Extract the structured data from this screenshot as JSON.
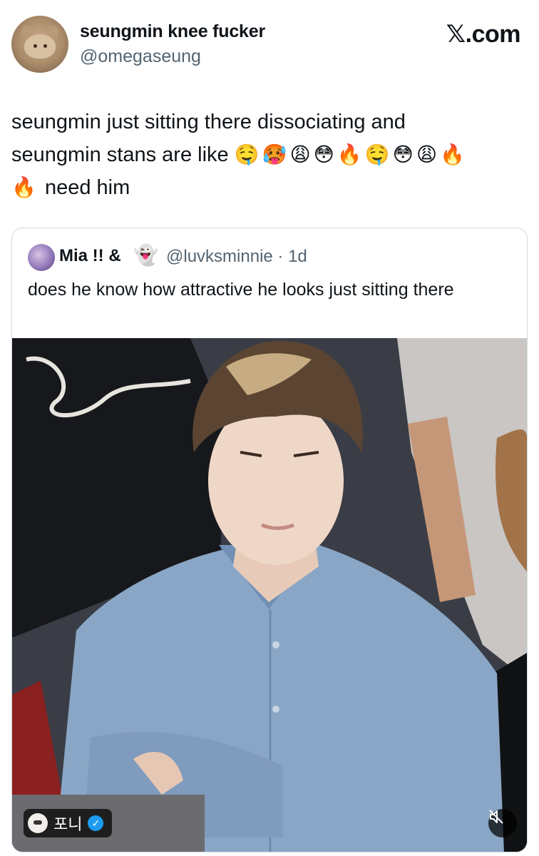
{
  "tweet": {
    "author": {
      "display_name": "seungmin knee fucker",
      "handle": "@omegaseung"
    },
    "brand": "𝕏.com",
    "text_line_1": "seungmin just sitting there dissociating and",
    "text_line_2": "seungmin stans are like",
    "emojis_line_2": [
      "🤤",
      "🥵",
      "😩",
      "😳",
      "🔥",
      "🤤",
      "😳",
      "😩",
      "🔥"
    ],
    "emoji_line_3": "🔥",
    "text_line_3": "need him"
  },
  "quote": {
    "display_name": "Mia !! &",
    "emoji": "👻",
    "handle_time": "@luvksminnie · 1d",
    "text": "does he know how attractive he looks just sitting there",
    "media": {
      "badge_label": "포니",
      "badge_verified_icon": "verified-check-icon",
      "mute_icon": "muted-speaker-icon"
    }
  },
  "colors": {
    "text": "#0f1419",
    "secondary_text": "#536471",
    "card_border": "#cfd9de",
    "verified": "#1d9bf0"
  }
}
